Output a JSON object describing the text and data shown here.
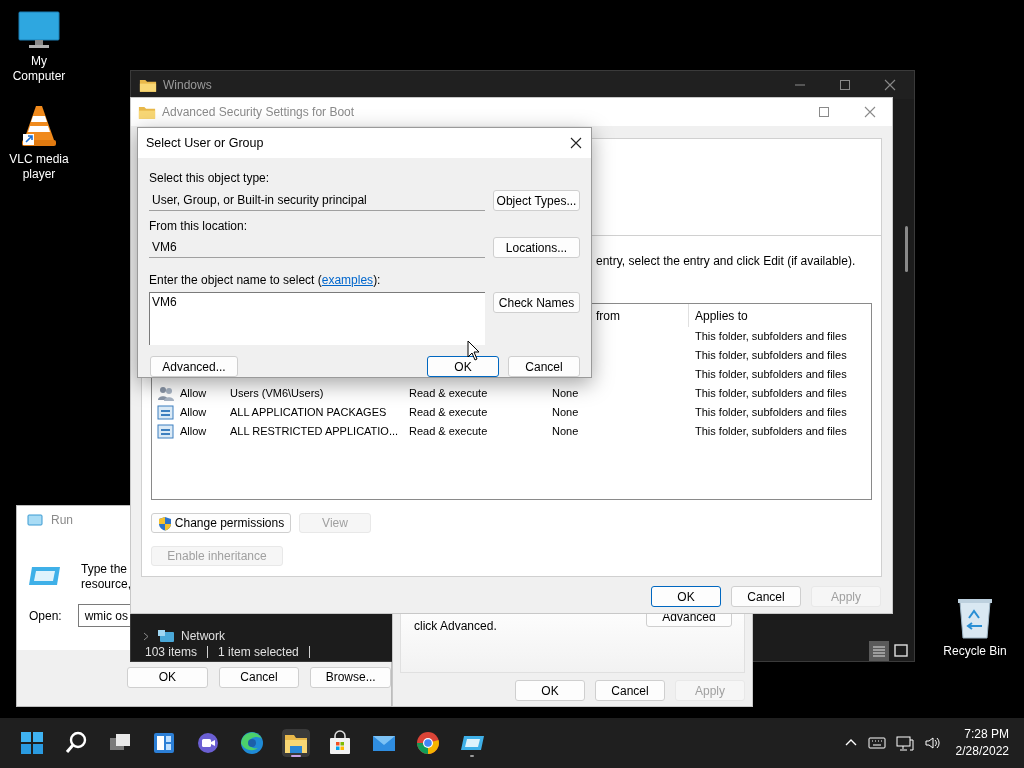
{
  "desktop_icons": [
    {
      "kind": "computer",
      "label": "My Computer"
    },
    {
      "kind": "vlc",
      "label": "VLC media player"
    },
    {
      "kind": "recycle",
      "label": "Recycle Bin"
    }
  ],
  "run_dialog": {
    "title": "Run",
    "description_lines": [
      "Type the",
      "resource,"
    ],
    "open_label": "Open:",
    "open_value": "wmic os",
    "buttons": [
      "OK",
      "Cancel",
      "Browse..."
    ]
  },
  "explorer_window": {
    "title": "Windows",
    "nav_items": [
      {
        "label": "Network"
      }
    ],
    "status_bar": [
      "103 items",
      "1 item selected"
    ],
    "view_buttons": [
      {
        "kind": "details",
        "selected": true
      },
      {
        "kind": "tiles",
        "selected": false
      }
    ]
  },
  "properties_window": {
    "text": "click Advanced.",
    "advanced_button": "Advanced",
    "buttons": [
      {
        "label": "OK",
        "disabled": false
      },
      {
        "label": "Cancel",
        "disabled": false
      },
      {
        "label": "Apply",
        "disabled": true
      }
    ]
  },
  "advanced_security_window": {
    "title": "Advanced Security Settings for Boot",
    "instruction": "entry, select the entry and click Edit (if available).",
    "columns": [
      "from",
      "Applies to"
    ],
    "rows": [
      {
        "applies_to": "This folder, subfolders and files"
      },
      {
        "applies_to": "This folder, subfolders and files"
      },
      {
        "applies_to": "This folder, subfolders and files"
      },
      {
        "kind": "users",
        "type": "Allow",
        "principal": "Users (VM6\\Users)",
        "access": "Read & execute",
        "inherited_from": "None",
        "applies_to": "This folder, subfolders and files"
      },
      {
        "kind": "package",
        "type": "Allow",
        "principal": "ALL APPLICATION PACKAGES",
        "access": "Read & execute",
        "inherited_from": "None",
        "applies_to": "This folder, subfolders and files"
      },
      {
        "kind": "package",
        "type": "Allow",
        "principal": "ALL RESTRICTED APPLICATIO...",
        "access": "Read & execute",
        "inherited_from": "None",
        "applies_to": "This folder, subfolders and files"
      }
    ],
    "actions": [
      {
        "label": "Change permissions",
        "shield": true,
        "disabled": false
      },
      {
        "label": "View",
        "shield": false,
        "disabled": true
      },
      {
        "label": "Enable inheritance",
        "shield": false,
        "disabled": true
      }
    ],
    "buttons": [
      {
        "label": "OK",
        "default": true,
        "disabled": false
      },
      {
        "label": "Cancel",
        "default": false,
        "disabled": false
      },
      {
        "label": "Apply",
        "default": false,
        "disabled": true
      }
    ]
  },
  "select_dialog": {
    "title": "Select User or Group",
    "object_type_label": "Select this object type:",
    "object_type": "User, Group, or Built-in security principal",
    "object_types_button": "Object Types...",
    "location_label": "From this location:",
    "location": "VM6",
    "locations_button": "Locations...",
    "name_label_before": "Enter the object name to select (",
    "name_label_link": "examples",
    "name_label_after": "):",
    "name_value": "VM6",
    "check_names_button": "Check Names",
    "buttons": [
      {
        "label": "Advanced...",
        "default": false
      },
      {
        "label": "OK",
        "default": true
      },
      {
        "label": "Cancel",
        "default": false
      }
    ]
  },
  "taskbar": {
    "apps": [
      {
        "kind": "start",
        "active": false,
        "running": false
      },
      {
        "kind": "search",
        "active": false,
        "running": false
      },
      {
        "kind": "task-view",
        "active": false,
        "running": false
      },
      {
        "kind": "widgets",
        "active": false,
        "running": false
      },
      {
        "kind": "chat",
        "active": false,
        "running": false
      },
      {
        "kind": "edge",
        "active": false,
        "running": false
      },
      {
        "kind": "explorer",
        "active": true,
        "running": true
      },
      {
        "kind": "store",
        "active": false,
        "running": false
      },
      {
        "kind": "mail",
        "active": false,
        "running": false
      },
      {
        "kind": "chrome",
        "active": false,
        "running": false
      },
      {
        "kind": "run",
        "active": false,
        "running": true
      }
    ],
    "time": "7:28 PM",
    "date": "2/28/2022"
  }
}
